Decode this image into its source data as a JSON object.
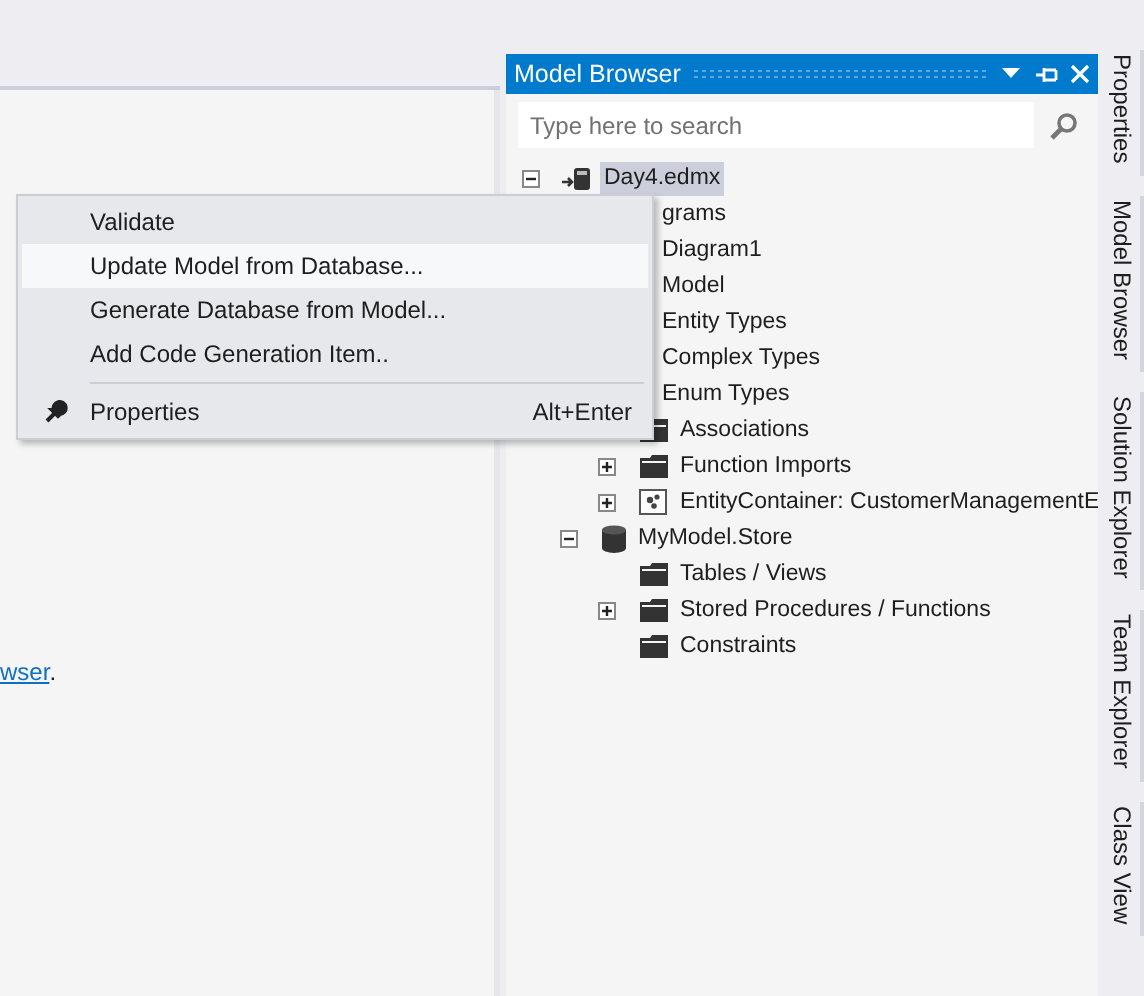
{
  "editor": {
    "link": "wser",
    "text_after": "."
  },
  "model_browser": {
    "title": "Model Browser",
    "search": {
      "placeholder": "Type here to search"
    },
    "tree": [
      {
        "label": "Day4.edmx",
        "kind": "edmx",
        "expanded": true,
        "selected": true,
        "children": [
          {
            "label": "grams",
            "kind": "partial",
            "selected": false,
            "children": [
              {
                "label": "Diagram1",
                "kind": "partial",
                "selected": false
              }
            ]
          },
          {
            "label": "Model",
            "kind": "partial",
            "selected": false,
            "children": [
              {
                "label": "Entity Types",
                "kind": "partial",
                "selected": false
              },
              {
                "label": "Complex Types",
                "kind": "partial",
                "selected": false
              },
              {
                "label": "Enum Types",
                "kind": "partial",
                "selected": false
              },
              {
                "label": "Associations",
                "kind": "folder",
                "selected": false
              },
              {
                "label": "Function Imports",
                "kind": "folder",
                "expanded": false,
                "selected": false
              },
              {
                "label": "EntityContainer: CustomerManagementE",
                "kind": "container",
                "expanded": false,
                "selected": false
              }
            ]
          },
          {
            "label": "MyModel.Store",
            "kind": "store",
            "expanded": true,
            "selected": false,
            "children": [
              {
                "label": "Tables / Views",
                "kind": "folder",
                "selected": false
              },
              {
                "label": "Stored Procedures / Functions",
                "kind": "folder",
                "expanded": false,
                "selected": false
              },
              {
                "label": "Constraints",
                "kind": "folder",
                "selected": false
              }
            ]
          }
        ]
      }
    ]
  },
  "side_tabs": [
    {
      "label": "Properties"
    },
    {
      "label": "Model Browser"
    },
    {
      "label": "Solution Explorer"
    },
    {
      "label": "Team Explorer"
    },
    {
      "label": "Class View"
    }
  ],
  "context_menu": [
    {
      "kind": "plain",
      "label": "Validate",
      "selected": false
    },
    {
      "kind": "plain",
      "label": "Update Model from Database...",
      "selected": true
    },
    {
      "kind": "plain",
      "label": "Generate Database from Model...",
      "selected": false
    },
    {
      "kind": "plain",
      "label": "Add Code Generation Item..",
      "selected": false
    },
    {
      "kind": "separator"
    },
    {
      "kind": "tool",
      "label": "Properties",
      "shortcut": "Alt+Enter",
      "selected": false
    }
  ]
}
